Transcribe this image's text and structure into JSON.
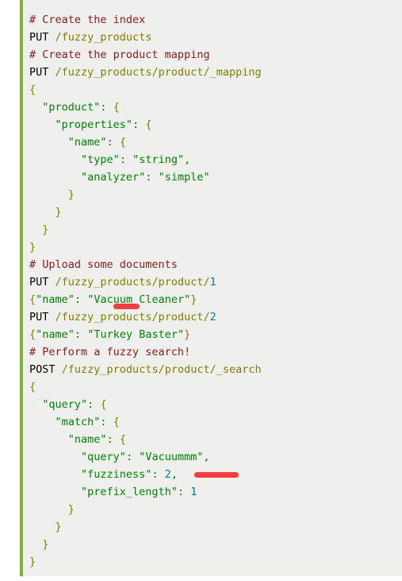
{
  "window": {
    "title": "Fuzzy Search Code Block",
    "background_color": "#ffffff",
    "panel_color": "#efefee",
    "accent_bar_color": "#7cb434"
  },
  "theme": {
    "comment_color": "#8b1a1a",
    "keyword_color": "#000000",
    "path_color": "#808000",
    "string_color": "#008200",
    "number_color": "#007a9e",
    "brace_color": "#808000",
    "annotation_color": "#f43030"
  },
  "code_block": {
    "language": "elasticsearch-rest",
    "lines": [
      {
        "n": 1,
        "text": "# Create the index"
      },
      {
        "n": 2,
        "text": "PUT /fuzzy_products"
      },
      {
        "n": 3,
        "text": "# Create the product mapping"
      },
      {
        "n": 4,
        "text": "PUT /fuzzy_products/product/_mapping"
      },
      {
        "n": 5,
        "text": "{"
      },
      {
        "n": 6,
        "text": "  \"product\": {"
      },
      {
        "n": 7,
        "text": "    \"properties\": {"
      },
      {
        "n": 8,
        "text": "      \"name\": {"
      },
      {
        "n": 9,
        "text": "        \"type\": \"string\","
      },
      {
        "n": 10,
        "text": "        \"analyzer\": \"simple\""
      },
      {
        "n": 11,
        "text": "      }"
      },
      {
        "n": 12,
        "text": "    }"
      },
      {
        "n": 13,
        "text": "  }"
      },
      {
        "n": 14,
        "text": "}"
      },
      {
        "n": 15,
        "text": "# Upload some documents"
      },
      {
        "n": 16,
        "text": "PUT /fuzzy_products/product/1"
      },
      {
        "n": 17,
        "text": "{\"name\": \"Vacuum Cleaner\"}"
      },
      {
        "n": 18,
        "text": "PUT /fuzzy_products/product/2"
      },
      {
        "n": 19,
        "text": "{\"name\": \"Turkey Baster\"}"
      },
      {
        "n": 20,
        "text": "# Perform a fuzzy search!"
      },
      {
        "n": 21,
        "text": "POST /fuzzy_products/product/_search"
      },
      {
        "n": 22,
        "text": "{"
      },
      {
        "n": 23,
        "text": "  \"query\": {"
      },
      {
        "n": 24,
        "text": "    \"match\": {"
      },
      {
        "n": 25,
        "text": "      \"name\": {"
      },
      {
        "n": 26,
        "text": "        \"query\": \"Vacuummm\","
      },
      {
        "n": 27,
        "text": "        \"fuzziness\": 2,"
      },
      {
        "n": 28,
        "text": "        \"prefix_length\": 1"
      },
      {
        "n": 29,
        "text": "      }"
      },
      {
        "n": 30,
        "text": "    }"
      },
      {
        "n": 31,
        "text": "  }"
      },
      {
        "n": 32,
        "text": "}"
      }
    ],
    "tokens": {
      "comment_create_index": "# Create the index",
      "comment_create_mapping": "# Create the product mapping",
      "comment_upload_docs": "# Upload some documents",
      "comment_fuzzy_search": "# Perform a fuzzy search!",
      "verb_put": "PUT",
      "verb_post": "POST",
      "path_index": "/fuzzy_products",
      "path_mapping": "/fuzzy_products/product/_mapping",
      "path_doc_1": "/fuzzy_products/product/1",
      "path_doc_2": "/fuzzy_products/product/2",
      "path_search": "/fuzzy_products/product/_search",
      "doc_1_body": "{\"name\": \"Vacuum Cleaner\"}",
      "doc_2_body": "{\"name\": \"Turkey Baster\"}",
      "field_product": "\"product\"",
      "field_properties": "\"properties\"",
      "field_name": "\"name\"",
      "field_type": "\"type\"",
      "value_string": "\"string\"",
      "field_analyzer": "\"analyzer\"",
      "value_simple": "\"simple\"",
      "field_query": "\"query\"",
      "field_match": "\"match\"",
      "value_vacuummm": "\"Vacuummm\"",
      "field_fuzziness": "\"fuzziness\"",
      "value_fuzziness": "2",
      "field_prefix_length": "\"prefix_length\"",
      "value_prefix_length": "1"
    }
  },
  "annotations": [
    {
      "id": "mark-vacuum",
      "shape": "underline-stroke",
      "color": "#f43030",
      "targets_text": "Vacuum",
      "on_line": 17
    },
    {
      "id": "mark-fuzziness",
      "shape": "underline-stroke",
      "color": "#f43030",
      "targets_text": "\"fuzziness\": 2,",
      "on_line": 27
    }
  ]
}
